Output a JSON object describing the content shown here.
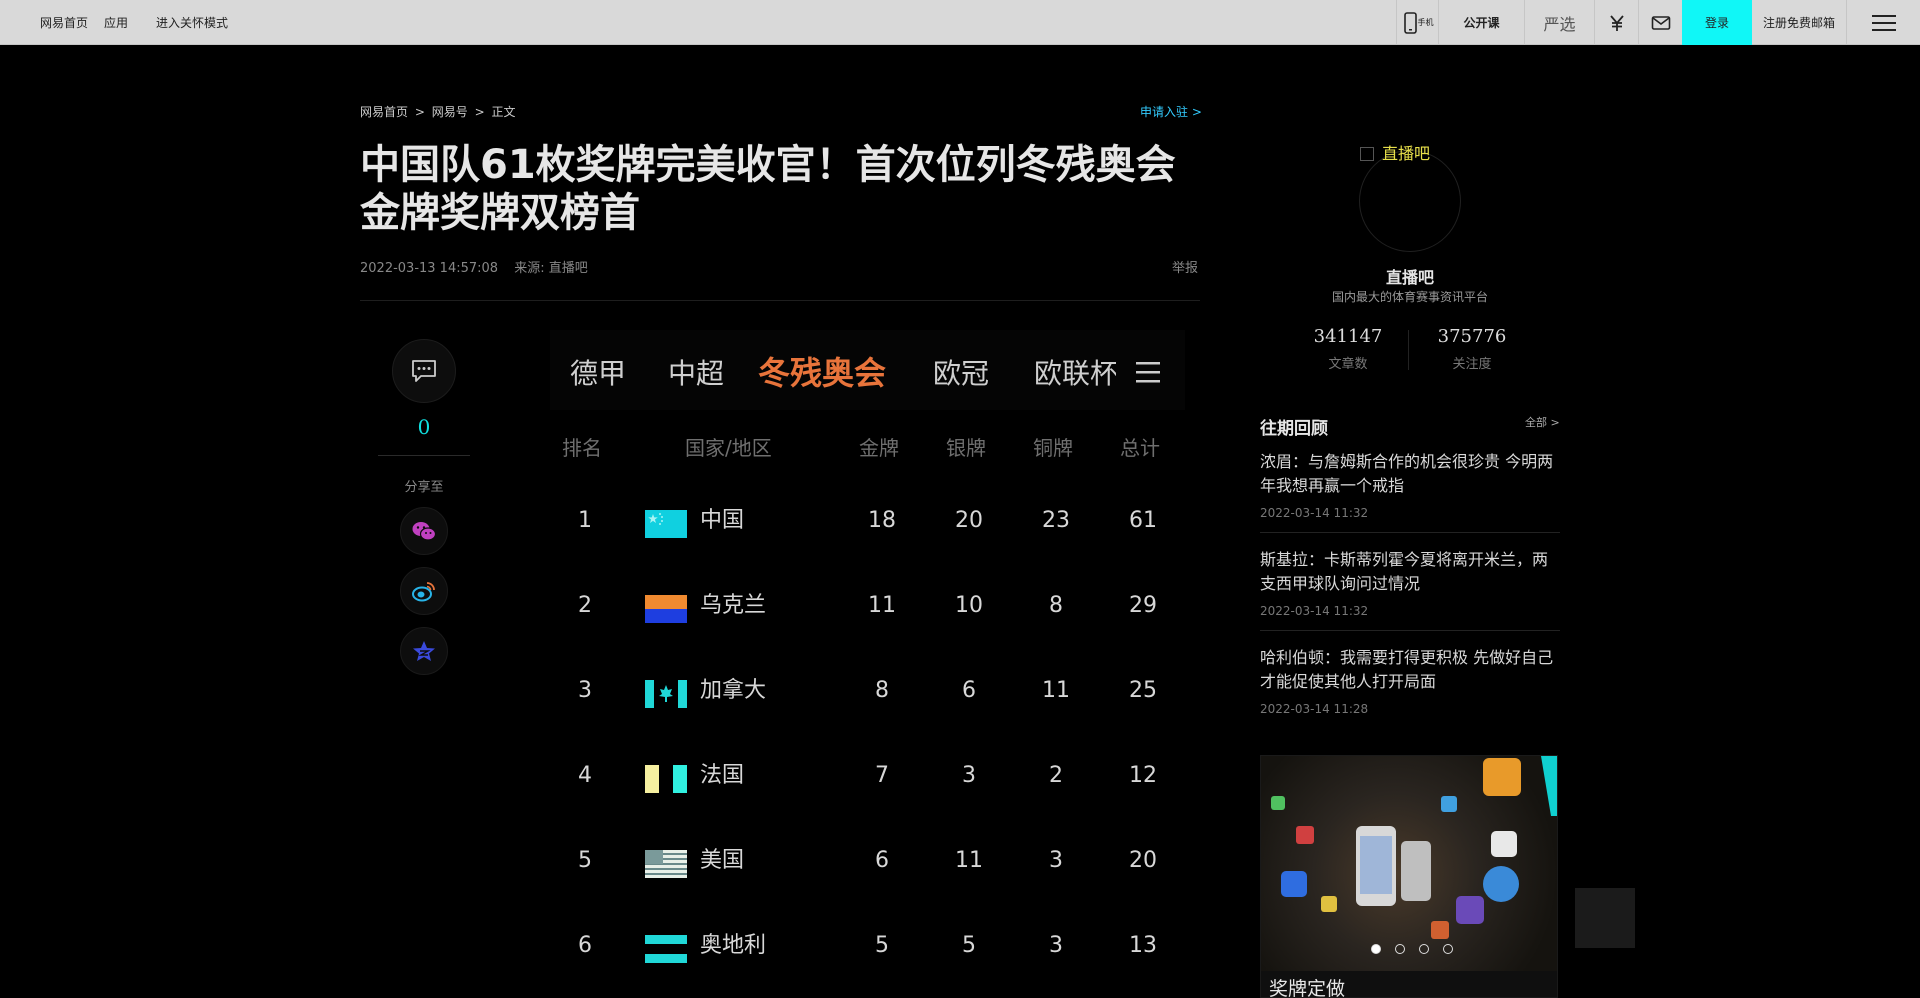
{
  "topbar": {
    "left": [
      "网易首页",
      "应用",
      "进入关怀模式"
    ],
    "phone_label": "手机",
    "open_course": "公开课",
    "yanxuan": "严选",
    "login": "登录",
    "register": "注册免费邮箱"
  },
  "breadcrumb": [
    "网易首页",
    ">",
    "网易号",
    ">",
    "正文"
  ],
  "apply": "申请入驻 >",
  "article": {
    "title": "中国队61枚奖牌完美收官！首次位列冬残奥会金牌奖牌双榜首",
    "time": "2022-03-13 14:57:08",
    "source": "来源: 直播吧",
    "report": "举报"
  },
  "social": {
    "comment_count": "0",
    "share_label": "分享至"
  },
  "medal_table": {
    "tabs": [
      "德甲",
      "中超",
      "冬残奥会",
      "欧冠",
      "欧联杯"
    ],
    "active_tab": 2,
    "headers": [
      "排名",
      "国家/地区",
      "金牌",
      "银牌",
      "铜牌",
      "总计"
    ],
    "rows": [
      {
        "rank": "1",
        "country": "中国",
        "gold": "18",
        "silver": "20",
        "bronze": "23",
        "total": "61"
      },
      {
        "rank": "2",
        "country": "乌克兰",
        "gold": "11",
        "silver": "10",
        "bronze": "8",
        "total": "29"
      },
      {
        "rank": "3",
        "country": "加拿大",
        "gold": "8",
        "silver": "6",
        "bronze": "11",
        "total": "25"
      },
      {
        "rank": "4",
        "country": "法国",
        "gold": "7",
        "silver": "3",
        "bronze": "2",
        "total": "12"
      },
      {
        "rank": "5",
        "country": "美国",
        "gold": "6",
        "silver": "11",
        "bronze": "3",
        "total": "20"
      },
      {
        "rank": "6",
        "country": "奥地利",
        "gold": "5",
        "silver": "5",
        "bronze": "3",
        "total": "13"
      }
    ]
  },
  "profile": {
    "avatar_alt": "直播吧",
    "name": "直播吧",
    "desc": "国内最大的体育赛事资讯平台",
    "articles": "341147",
    "articles_label": "文章数",
    "followers": "375776",
    "followers_label": "关注度"
  },
  "past": {
    "title": "往期回顾",
    "all": "全部 >",
    "items": [
      {
        "title": "浓眉：与詹姆斯合作的机会很珍贵 今明两年我想再赢一个戒指",
        "date": "2022-03-14 11:32"
      },
      {
        "title": "斯基拉：卡斯蒂列霍今夏将离开米兰，两支西甲球队询问过情况",
        "date": "2022-03-14 11:32"
      },
      {
        "title": "哈利伯顿：我需要打得更积极 先做好自己才能促使其他人打开局面",
        "date": "2022-03-14 11:28"
      }
    ]
  },
  "ad": {
    "caption": "奖牌定做"
  }
}
